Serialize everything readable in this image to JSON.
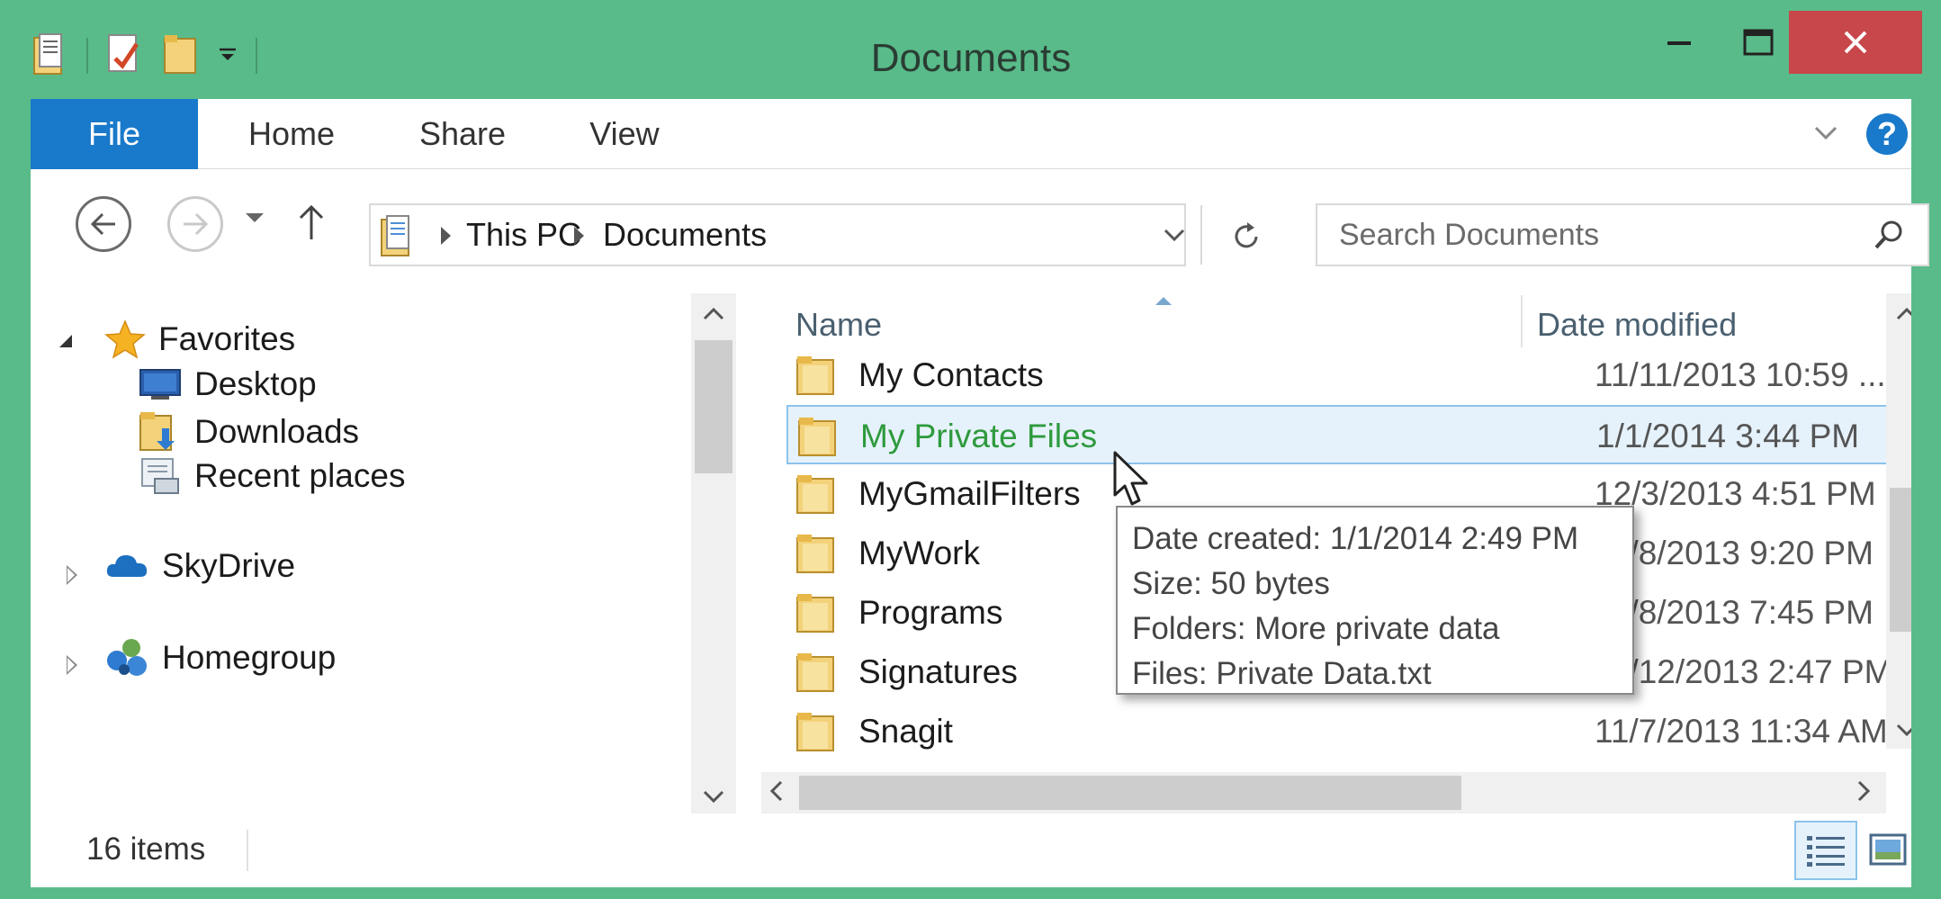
{
  "window": {
    "title": "Documents"
  },
  "ribbon": {
    "tabs": [
      {
        "label": "File"
      },
      {
        "label": "Home"
      },
      {
        "label": "Share"
      },
      {
        "label": "View"
      }
    ],
    "help_label": "?"
  },
  "navbar": {
    "breadcrumb": [
      "This PC",
      "Documents"
    ],
    "search_placeholder": "Search Documents"
  },
  "navpane": {
    "favorites": {
      "label": "Favorites",
      "items": [
        {
          "label": "Desktop",
          "icon": "desktop-icon"
        },
        {
          "label": "Downloads",
          "icon": "downloads-folder-icon"
        },
        {
          "label": "Recent places",
          "icon": "recent-places-icon"
        }
      ]
    },
    "skydrive": {
      "label": "SkyDrive"
    },
    "homegroup": {
      "label": "Homegroup"
    }
  },
  "filelist": {
    "columns": {
      "name": "Name",
      "date": "Date modified"
    },
    "rows": [
      {
        "name": "My Contacts",
        "date": "11/11/2013 10:59 ..."
      },
      {
        "name": "My Private Files",
        "date": "1/1/2014 3:44 PM",
        "selected": true
      },
      {
        "name": "MyGmailFilters",
        "date": "12/3/2013 4:51 PM"
      },
      {
        "name": "MyWork",
        "date": "11/8/2013 9:20 PM"
      },
      {
        "name": "Programs",
        "date": "11/8/2013 7:45 PM"
      },
      {
        "name": "Signatures",
        "date": "11/12/2013 2:47 PM"
      },
      {
        "name": "Snagit",
        "date": "11/7/2013 11:34 AM"
      }
    ]
  },
  "tooltip": {
    "lines": [
      "Date created: 1/1/2014 2:49 PM",
      "Size: 50 bytes",
      "Folders: More private data",
      "Files: Private Data.txt"
    ]
  },
  "statusbar": {
    "item_count": "16 items"
  },
  "colors": {
    "window_frame": "#59bb8a",
    "file_tab": "#1979ca",
    "close_button": "#c7474a",
    "selection_fill": "#e6f2fb",
    "selection_border": "#8bc3ec",
    "selected_text": "#2e9a3d"
  }
}
